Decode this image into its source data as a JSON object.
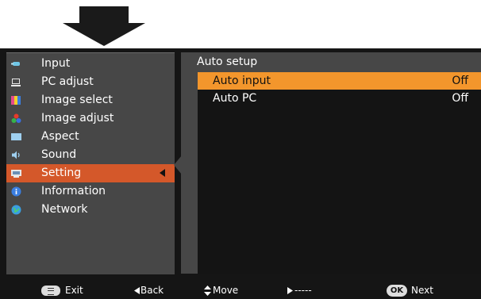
{
  "colors": {
    "accent_selected": "#d4582a",
    "list_selected": "#f3962c",
    "panel_bg": "#474747",
    "list_bg": "#141414"
  },
  "menu": {
    "items": [
      {
        "label": "Input",
        "icon": "input-icon"
      },
      {
        "label": "PC adjust",
        "icon": "pc-adjust-icon"
      },
      {
        "label": "Image select",
        "icon": "image-select-icon"
      },
      {
        "label": "Image adjust",
        "icon": "image-adjust-icon"
      },
      {
        "label": "Aspect",
        "icon": "aspect-icon"
      },
      {
        "label": "Sound",
        "icon": "sound-icon"
      },
      {
        "label": "Setting",
        "icon": "setting-icon",
        "selected": true
      },
      {
        "label": "Information",
        "icon": "information-icon"
      },
      {
        "label": "Network",
        "icon": "network-icon"
      }
    ]
  },
  "submenu": {
    "title": "Auto setup",
    "items": [
      {
        "label": "Auto input",
        "value": "Off",
        "selected": true
      },
      {
        "label": "Auto PC",
        "value": "Off",
        "selected": false
      }
    ]
  },
  "footer": {
    "exit": "Exit",
    "back": "Back",
    "move": "Move",
    "right": "-----",
    "ok": "OK",
    "next": "Next"
  }
}
